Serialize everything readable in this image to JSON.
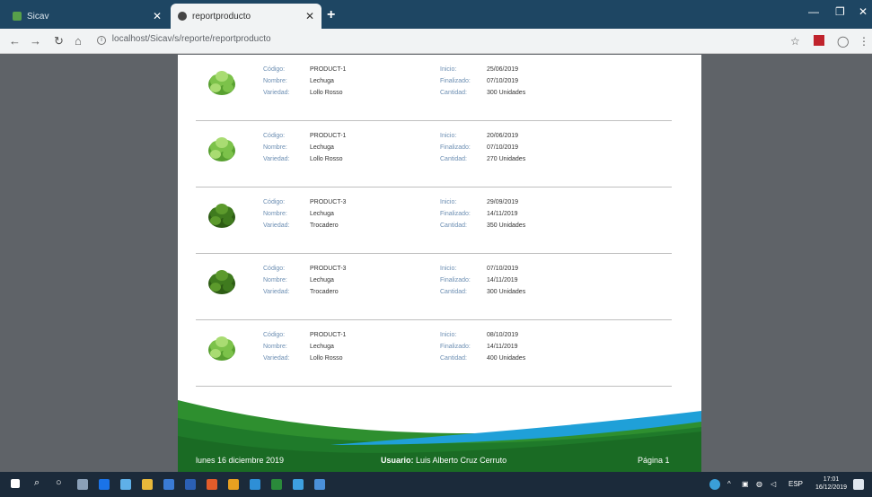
{
  "browser": {
    "tabs": [
      {
        "title": "Sicav",
        "active": false
      },
      {
        "title": "reportproducto",
        "active": true
      }
    ],
    "url": "localhost/Sicav/s/reporte/reportproducto"
  },
  "labels": {
    "codigo": "Código:",
    "nombre": "Nombre:",
    "variedad": "Variedad:",
    "inicio": "Inicio:",
    "finalizado": "Finalizado:",
    "cantidad": "Cantidad:"
  },
  "records": [
    {
      "codigo": "PRODUCT-1",
      "nombre": "Lechuga",
      "variedad": "Lollo Rosso",
      "inicio": "25/06/2019",
      "finalizado": "07/10/2019",
      "cantidad": "300 Unidades",
      "icon": "lettuce-light-icon"
    },
    {
      "codigo": "PRODUCT-1",
      "nombre": "Lechuga",
      "variedad": "Lollo Rosso",
      "inicio": "20/06/2019",
      "finalizado": "07/10/2019",
      "cantidad": "270 Unidades",
      "icon": "lettuce-light-icon"
    },
    {
      "codigo": "PRODUCT-3",
      "nombre": "Lechuga",
      "variedad": "Trocadero",
      "inicio": "29/09/2019",
      "finalizado": "14/11/2019",
      "cantidad": "350 Unidades",
      "icon": "lettuce-dark-icon"
    },
    {
      "codigo": "PRODUCT-3",
      "nombre": "Lechuga",
      "variedad": "Trocadero",
      "inicio": "07/10/2019",
      "finalizado": "14/11/2019",
      "cantidad": "300 Unidades",
      "icon": "lettuce-dark-icon"
    },
    {
      "codigo": "PRODUCT-1",
      "nombre": "Lechuga",
      "variedad": "Lollo Rosso",
      "inicio": "08/10/2019",
      "finalizado": "14/11/2019",
      "cantidad": "400 Unidades",
      "icon": "lettuce-light-icon"
    }
  ],
  "footer": {
    "date": "lunes 16 diciembre 2019",
    "user_label": "Usuario:",
    "user_name": "Luis Alberto Cruz Cerruto",
    "page": "Página 1"
  },
  "taskbar": {
    "language": "ESP",
    "time": "17:01",
    "date": "16/12/2019"
  },
  "colors": {
    "label_blue": "#6d8fb3",
    "footer_green": "#1f7a2a",
    "wave_blue": "#1fa0d8",
    "titlebar": "#1e4663"
  }
}
